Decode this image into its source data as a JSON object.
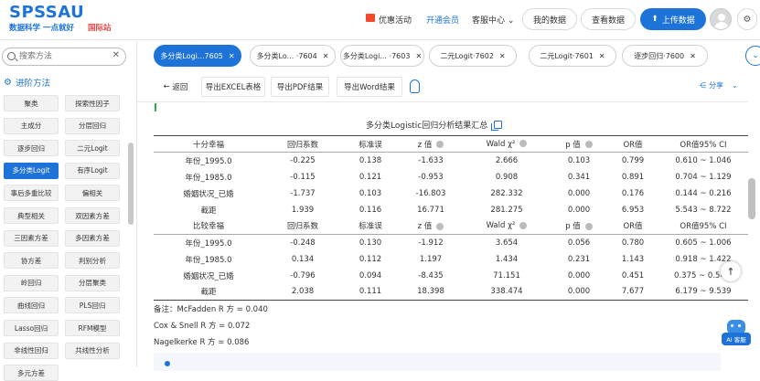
{
  "header": {
    "logo": "SPSSAU",
    "tagline": "数据科学 一点就好",
    "intl": "国际站",
    "nav": [
      "优惠活动",
      "开通会员",
      "客服中心"
    ],
    "my_data": "我的数据",
    "view_data": "查看数据",
    "upload": "上传数据"
  },
  "sidebar": {
    "search_placeholder": "搜索方法",
    "category": "进阶方法",
    "methods": [
      "聚类",
      "探索性因子",
      "主成分",
      "分层回归",
      "逐步回归",
      "二元Logit",
      "多分类Logit",
      "有序Logit",
      "事后多重比较",
      "偏相关",
      "典型相关",
      "双因素方差",
      "三因素方差",
      "多因素方差",
      "协方差",
      "判别分析",
      "岭回归",
      "分层聚类",
      "曲线回归",
      "PLS回归",
      "Lasso回归",
      "RFM模型",
      "非线性回归",
      "共线性分析",
      "多元方差"
    ]
  },
  "tabs": [
    "多分类Logi...7605",
    "多分类Lo... ·7604",
    "多分类Logi... ·7603",
    "二元Logit·7602",
    "二元Logit·7601",
    "逐步回归·7600"
  ],
  "toolbar": {
    "back": "返回",
    "export_excel": "导出EXCEL表格",
    "export_pdf": "导出PDF结果",
    "export_word": "导出Word结果",
    "share": "分享"
  },
  "table": {
    "title": "多分类Logistic回归分析结果汇总",
    "headers": [
      "回归系数",
      "标准误",
      "z 值",
      "Wald χ²",
      "p 值",
      "OR值",
      "OR值95% CI"
    ],
    "groups": [
      {
        "name": "十分幸福",
        "rows": [
          [
            "年份_1995.0",
            "-0.225",
            "0.138",
            "-1.633",
            "2.666",
            "0.103",
            "0.799",
            "0.610 ~ 1.046"
          ],
          [
            "年份_1985.0",
            "-0.115",
            "0.121",
            "-0.953",
            "0.908",
            "0.341",
            "0.891",
            "0.704 ~ 1.129"
          ],
          [
            "婚姻状况_已婚",
            "-1.737",
            "0.103",
            "-16.803",
            "282.332",
            "0.000",
            "0.176",
            "0.144 ~ 0.216"
          ],
          [
            "截距",
            "1.939",
            "0.116",
            "16.771",
            "281.275",
            "0.000",
            "6.953",
            "5.543 ~ 8.722"
          ]
        ]
      },
      {
        "name": "比较幸福",
        "rows": [
          [
            "年份_1995.0",
            "-0.248",
            "0.130",
            "-1.912",
            "3.654",
            "0.056",
            "0.780",
            "0.605 ~ 1.006"
          ],
          [
            "年份_1985.0",
            "0.134",
            "0.112",
            "1.197",
            "1.434",
            "0.231",
            "1.143",
            "0.918 ~ 1.422"
          ],
          [
            "婚姻状况_已婚",
            "-0.796",
            "0.094",
            "-8.435",
            "71.151",
            "0.000",
            "0.451",
            "0.375 ~ 0.54..."
          ],
          [
            "截距",
            "2.038",
            "0.111",
            "18.398",
            "338.474",
            "0.000",
            "7.677",
            "6.179 ~ 9.539"
          ]
        ]
      }
    ]
  },
  "notes": [
    "备注：McFadden R 方 = 0.040",
    "Cox & Snell R 方 = 0.072",
    "Nagelkerke R 方 = 0.086"
  ],
  "ai": "AI 客服",
  "colors": {
    "accent": "#1e73d8",
    "danger": "#e34a4a",
    "promo": "#f04a2b",
    "green": "#34a853"
  }
}
